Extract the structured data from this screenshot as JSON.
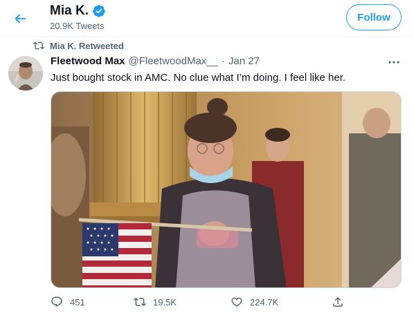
{
  "header": {
    "back_icon": "arrow-left-icon",
    "profile_name": "Mia K.",
    "verified_icon": "verified-badge-icon",
    "tweet_count": "20.9K Tweets",
    "follow_label": "Follow"
  },
  "retweet": {
    "icon": "retweet-icon",
    "label": "Mia K. Retweeted"
  },
  "tweet": {
    "avatar": "avatar-image",
    "author_name": "Fleetwood Max",
    "author_handle": "@FleetwoodMax__",
    "separator": "·",
    "date": "Jan 27",
    "more_icon": "more-options-icon",
    "text": "Just bought stock in AMC. No clue what I’m doing. I feel like her.",
    "media": "photo-woman-holding-flag",
    "actions": {
      "reply_count": "451",
      "retweet_count": "19.5K",
      "like_count": "224.7K",
      "share_icon": "share-icon"
    }
  },
  "colors": {
    "accent": "#1d9bf0",
    "muted_text": "#536471",
    "primary_text": "#0f1419",
    "divider": "#eff3f4"
  }
}
